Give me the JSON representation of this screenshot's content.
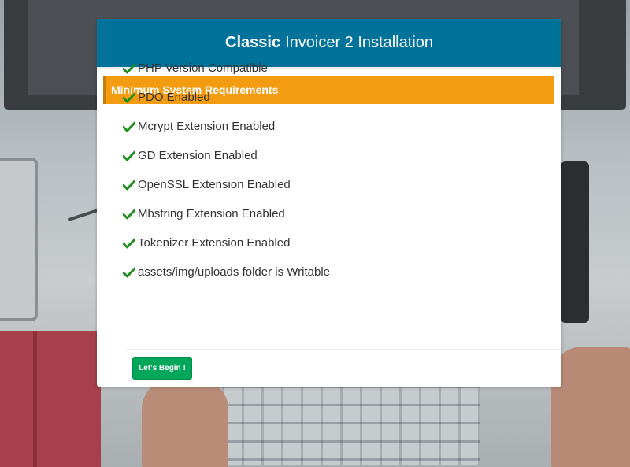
{
  "header": {
    "title_brand": "Classic",
    "title_rest": "Invoicer 2 Installation"
  },
  "requirements": {
    "heading": "Minimum System Requirements",
    "items": [
      {
        "label": "PHP Version Compatible",
        "status": "ok",
        "icon": "checkmark-icon"
      },
      {
        "label": "PDO Enabled",
        "status": "ok",
        "icon": "checkmark-icon"
      },
      {
        "label": "Mcrypt Extension Enabled",
        "status": "ok",
        "icon": "checkmark-icon"
      },
      {
        "label": "GD Extension Enabled",
        "status": "ok",
        "icon": "checkmark-icon"
      },
      {
        "label": "OpenSSL Extension Enabled",
        "status": "ok",
        "icon": "checkmark-icon"
      },
      {
        "label": "Mbstring Extension Enabled",
        "status": "ok",
        "icon": "checkmark-icon"
      },
      {
        "label": "Tokenizer Extension Enabled",
        "status": "ok",
        "icon": "checkmark-icon"
      },
      {
        "label": "assets/img/uploads folder is Writable",
        "status": "ok",
        "icon": "checkmark-icon"
      }
    ]
  },
  "actions": {
    "begin_label": "Let's Begin !"
  },
  "colors": {
    "header_bg": "#01729a",
    "panel_heading_bg": "#f39c12",
    "check_color": "#1e8e1e",
    "button_bg": "#00a65a"
  }
}
